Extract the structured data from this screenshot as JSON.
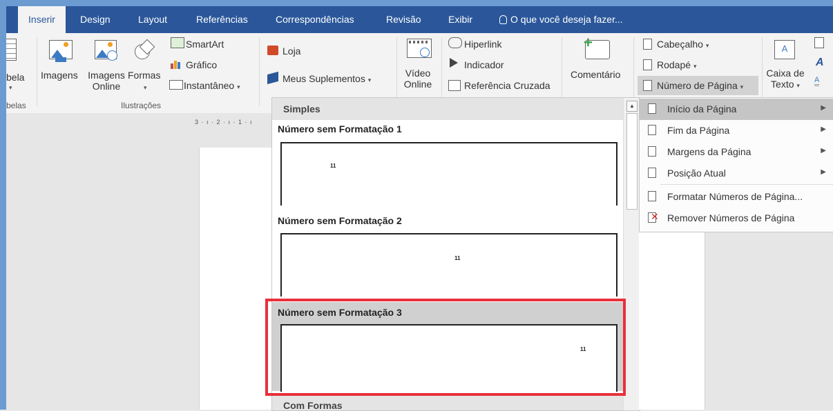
{
  "ribbon_tabs": [
    {
      "label": "Inserir",
      "active": true
    },
    {
      "label": "Design"
    },
    {
      "label": "Layout"
    },
    {
      "label": "Referências"
    },
    {
      "label": "Correspondências"
    },
    {
      "label": "Revisão"
    },
    {
      "label": "Exibir"
    }
  ],
  "tell_me": "O que você deseja fazer...",
  "ribbon": {
    "tabela_partial": "bela",
    "tabelas_group_partial": "belas",
    "imagens": "Imagens",
    "imagens_online_1": "Imagens",
    "imagens_online_2": "Online",
    "formas": "Formas",
    "smartart": "SmartArt",
    "grafico": "Gráfico",
    "instantaneo": "Instantâneo",
    "ilustracoes_group": "Ilustrações",
    "loja": "Loja",
    "meus_suplementos": "Meus Suplementos",
    "video_online_1": "Vídeo",
    "video_online_2": "Online",
    "hiperlink": "Hiperlink",
    "indicador": "Indicador",
    "referencia_cruzada": "Referência Cruzada",
    "comentario": "Comentário",
    "cabecalho": "Cabeçalho",
    "rodape": "Rodapé",
    "numero_de_pagina": "Número de Página",
    "caixa_de_texto_1": "Caixa de",
    "caixa_de_texto_2": "Texto"
  },
  "ruler_text": "3 · ı · 2 · ı · 1 · ı",
  "gallery": {
    "header": "Simples",
    "items": [
      {
        "title": "Número sem Formatação 1",
        "number": "11",
        "position": "left"
      },
      {
        "title": "Número sem Formatação 2",
        "number": "11",
        "position": "center"
      },
      {
        "title": "Número sem Formatação 3",
        "number": "11",
        "position": "right",
        "selected": true
      }
    ],
    "footer": "Com Formas"
  },
  "submenu": {
    "items": [
      {
        "label": "Início da Página",
        "has_arrow": true,
        "hover": true
      },
      {
        "label": "Fim da Página",
        "has_arrow": true
      },
      {
        "label": "Margens da Página",
        "has_arrow": true
      },
      {
        "label": "Posição Atual",
        "has_arrow": true
      },
      {
        "label": "Formatar Números de Página...",
        "has_arrow": false
      },
      {
        "label": "Remover Números de Página",
        "has_arrow": false
      }
    ]
  },
  "colors": {
    "tab_bar": "#2b579a",
    "highlight_border": "#e8303a"
  }
}
